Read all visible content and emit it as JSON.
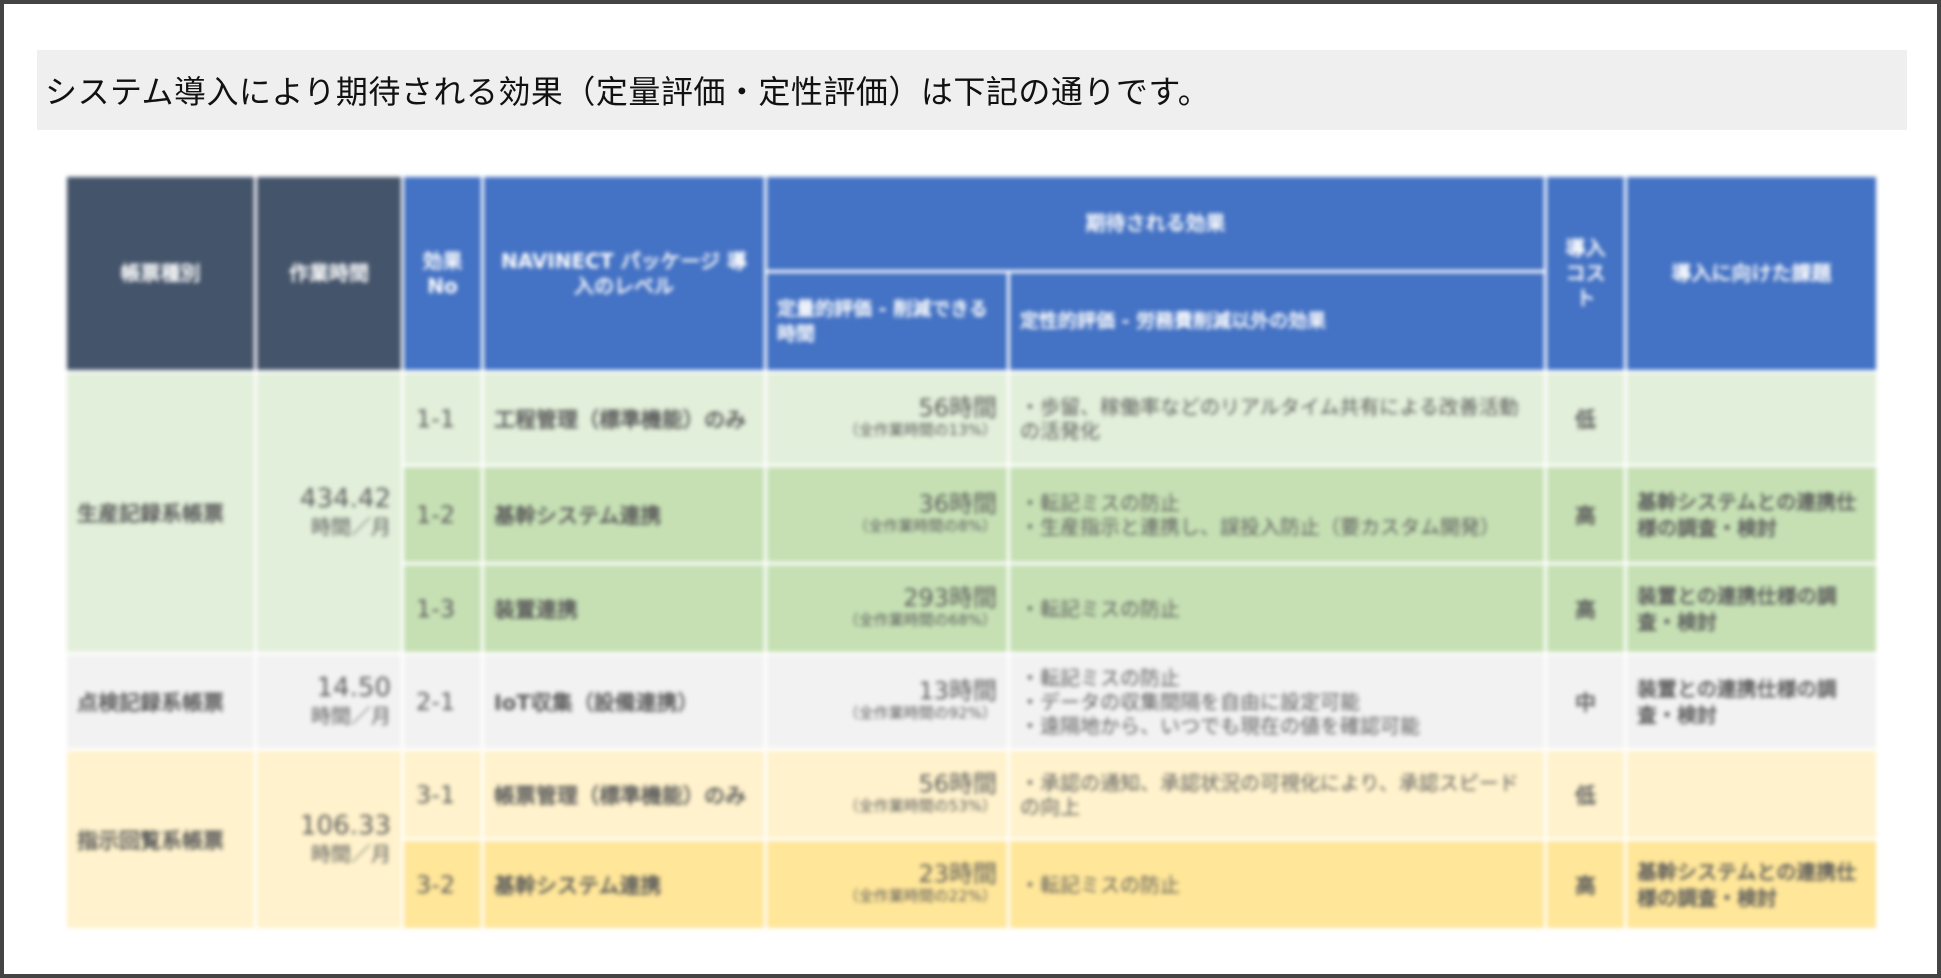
{
  "heading": "システム導入により期待される効果（定量評価・定性評価）は下記の通りです。",
  "headers": {
    "form_type": "帳票種別",
    "work_time": "作業時間",
    "effect_no": "効果 No",
    "level": "NAVINECT パッケージ 導入のレベル",
    "expected": "期待される効果",
    "quant": "定量的評価 - 削減できる時間",
    "qual": "定性的評価 - 労務費削減以外の効果",
    "cost": "導入 コスト",
    "issues": "導入に向けた課題"
  },
  "groups": [
    {
      "name": "生産記録系帳票",
      "time": "434.42",
      "unit": "時間／月"
    },
    {
      "name": "点検記録系帳票",
      "time": "14.50",
      "unit": "時間／月"
    },
    {
      "name": "指示回覧系帳票",
      "time": "106.33",
      "unit": "時間／月"
    }
  ],
  "rows": [
    {
      "no": "1-1",
      "level": "工程管理（標準機能）のみ",
      "hours": "56時間",
      "pct": "（全作業時間の13%）",
      "qual": [
        "・歩留、稼働率などのリアルタイム共有による改善活動の活発化"
      ],
      "cost": "低",
      "issue": ""
    },
    {
      "no": "1-2",
      "level": "基幹システム連携",
      "hours": "36時間",
      "pct": "（全作業時間の8%）",
      "qual": [
        "・転記ミスの防止",
        "・生産指示と連携し、誤投入防止（要カスタム開発）"
      ],
      "cost": "高",
      "issue": "基幹システムとの連携仕様の調査・検討"
    },
    {
      "no": "1-3",
      "level": "装置連携",
      "hours": "293時間",
      "pct": "（全作業時間の68%）",
      "qual": [
        "・転記ミスの防止"
      ],
      "cost": "高",
      "issue": "装置との連携仕様の調査・検討"
    },
    {
      "no": "2-1",
      "level": "IoT収集（設備連携）",
      "hours": "13時間",
      "pct": "（全作業時間の92%）",
      "qual": [
        "・転記ミスの防止",
        "・データの収集間隔を自由に設定可能",
        "・遠隔地から、いつでも現在の値を確認可能"
      ],
      "cost": "中",
      "issue": "装置との連携仕様の調査・検討"
    },
    {
      "no": "3-1",
      "level": "帳票管理（標準機能）のみ",
      "hours": "56時間",
      "pct": "（全作業時間の53%）",
      "qual": [
        "・承認の通知、承認状況の可視化により、承認スピードの向上"
      ],
      "cost": "低",
      "issue": ""
    },
    {
      "no": "3-2",
      "level": "基幹システム連携",
      "hours": "23時間",
      "pct": "（全作業時間の22%）",
      "qual": [
        "・転記ミスの防止"
      ],
      "cost": "高",
      "issue": "基幹システムとの連携仕様の調査・検討"
    }
  ]
}
